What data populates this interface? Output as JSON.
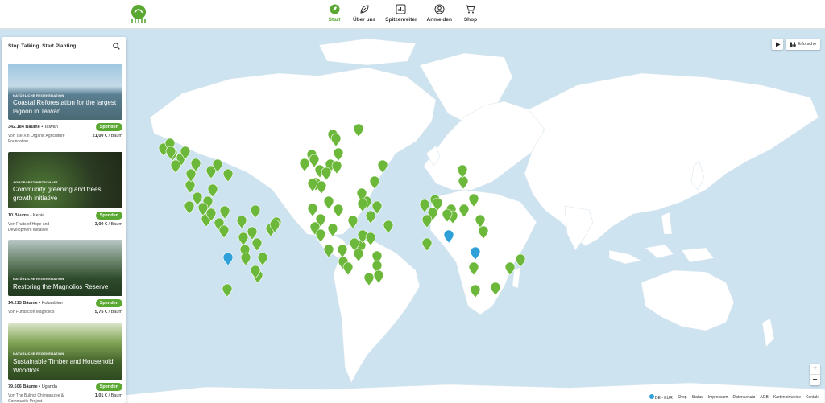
{
  "header": {
    "nav": [
      {
        "label": "Start",
        "icon": "leaf-badge-icon",
        "active": true
      },
      {
        "label": "Über uns",
        "icon": "leaf-icon",
        "active": false
      },
      {
        "label": "Spitzenreiter",
        "icon": "chart-icon",
        "active": false
      },
      {
        "label": "Anmelden",
        "icon": "user-icon",
        "active": false
      },
      {
        "label": "Shop",
        "icon": "cart-icon",
        "active": false
      }
    ]
  },
  "sidebar": {
    "search_label": "Stop Talking. Start Planting.",
    "cards": [
      {
        "tag": "NATÜRLICHE REGENERATION",
        "title": "Coastal Reforestation for the largest lagoon in Taiwan",
        "trees": "342.184 Bäume",
        "country": "Taiwan",
        "button": "Spenden",
        "org": "Von Tse-Xin Organic Agriculture Foundation",
        "price": "21,00 €",
        "unit": "/ Baum"
      },
      {
        "tag": "AGROFORSTWIRTSCHAFT",
        "title": "Community greening and trees growth initiative",
        "trees": "10 Bäume",
        "country": "Kenia",
        "button": "Spenden",
        "org": "Von Fruits of Hope and Development Initiative",
        "price": "3,00 €",
        "unit": "/ Baum"
      },
      {
        "tag": "NATÜRLICHE REGENERATION",
        "title": "Restoring the Magnolios Reserve",
        "trees": "14.213 Bäume",
        "country": "Kolumbien",
        "button": "Spenden",
        "org": "Von Fundación Magnolios",
        "price": "5,75 €",
        "unit": "/ Baum"
      },
      {
        "tag": "NATÜRLICHE REGENERATION",
        "title": "Sustainable Timber and Household Woodlots",
        "trees": "79.606 Bäume",
        "country": "Uganda",
        "button": "Spenden",
        "org": "Von The Bulindi Chimpanzee & Community Project",
        "price": "1,01 €",
        "unit": "/ Baum"
      }
    ]
  },
  "map_controls": {
    "explore_label": "Erforsche",
    "zoom_in": "+",
    "zoom_out": "−"
  },
  "footer": {
    "locale": "DE - EUR",
    "links": [
      "Shop",
      "Status",
      "Impressum",
      "Datenschutz",
      "AGB",
      "Kartenhinweise",
      "Kontakt"
    ]
  },
  "colors": {
    "accent": "#5aa832",
    "pin_green": "#6cb83a",
    "pin_blue": "#2fa0d8",
    "ocean": "#cde3f0",
    "land": "#ffffff"
  }
}
